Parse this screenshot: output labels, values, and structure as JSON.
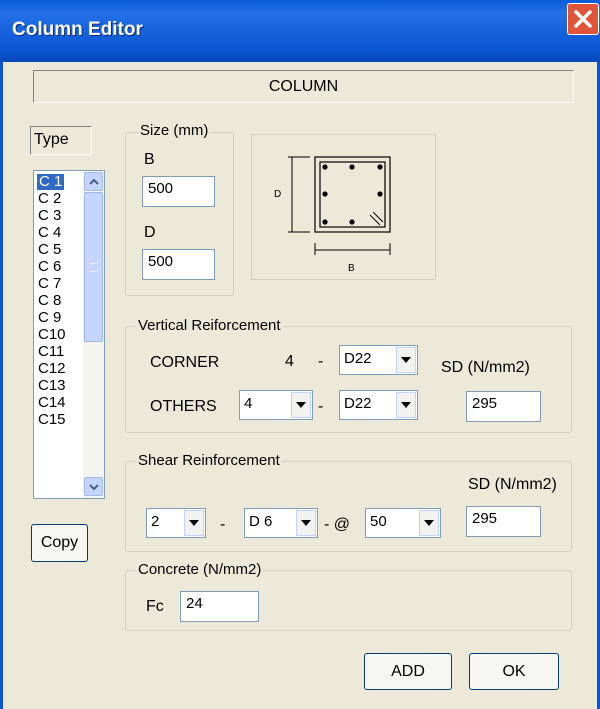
{
  "window": {
    "title": "Column Editor",
    "close_icon": "close-icon"
  },
  "header": {
    "label": "COLUMN"
  },
  "type_list": {
    "label": "Type",
    "items": [
      "C 1",
      "C 2",
      "C 3",
      "C 4",
      "C 5",
      "C 6",
      "C 7",
      "C 8",
      "C 9",
      "C10",
      "C11",
      "C12",
      "C13",
      "C14",
      "C15"
    ],
    "selected": "C 1"
  },
  "copy_button": "Copy",
  "size": {
    "legend": "Size (mm)",
    "b_label": "B",
    "b_value": "500",
    "d_label": "D",
    "d_value": "500"
  },
  "diagram": {
    "d_label": "D",
    "b_label": "B"
  },
  "vertical": {
    "legend": "Vertical Reiforcement",
    "corner_label": "CORNER",
    "corner_count": "4",
    "corner_dash": "-",
    "corner_bar": "D22",
    "others_label": "OTHERS",
    "others_count": "4",
    "others_dash": "-",
    "others_bar": "D22",
    "sd_label": "SD (N/mm2)",
    "sd_value": "295"
  },
  "shear": {
    "legend": "Shear Reinforcement",
    "sd_label": "SD (N/mm2)",
    "count": "2",
    "dash": "-",
    "bar": "D 6",
    "at_label": "- @",
    "spacing": "50",
    "sd_value": "295"
  },
  "concrete": {
    "legend": "Concrete (N/mm2)",
    "fc_label": "Fc",
    "fc_value": "24"
  },
  "buttons": {
    "add": "ADD",
    "ok": "OK"
  },
  "colors": {
    "titlebar": "#0a56d4",
    "selection": "#316ac5",
    "close": "#e0553a"
  }
}
